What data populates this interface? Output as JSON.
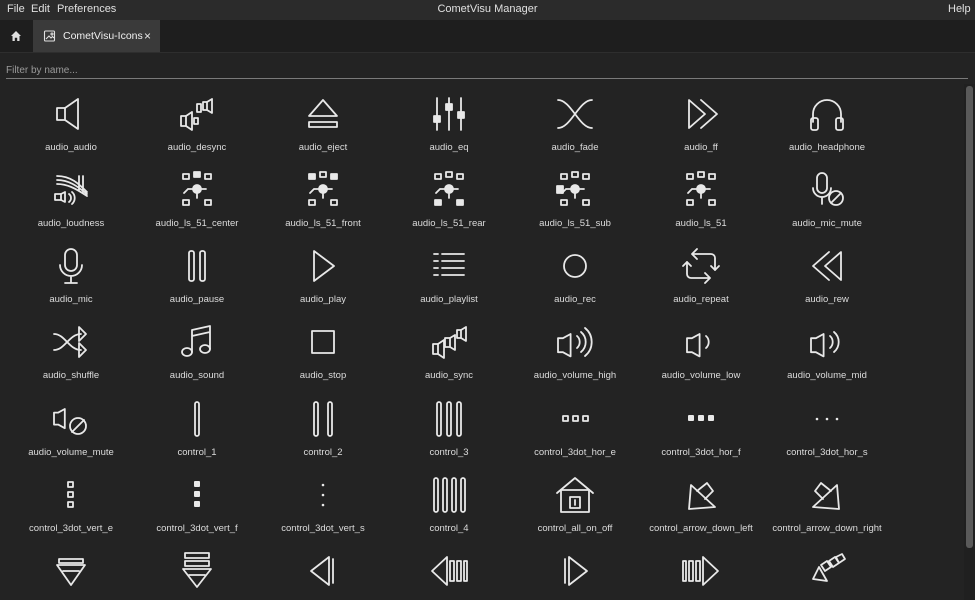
{
  "menubar": {
    "file": "File",
    "edit": "Edit",
    "preferences": "Preferences",
    "title": "CometVisu Manager",
    "help": "Help"
  },
  "tab": {
    "label": "CometVisu-Icons",
    "close": "×"
  },
  "filter": {
    "placeholder": "Filter by name..."
  },
  "icons": [
    {
      "label": "audio_audio",
      "icon": "speaker-icon"
    },
    {
      "label": "audio_desync",
      "icon": "speakers-desync-icon"
    },
    {
      "label": "audio_eject",
      "icon": "eject-icon"
    },
    {
      "label": "audio_eq",
      "icon": "equalizer-icon"
    },
    {
      "label": "audio_fade",
      "icon": "fade-icon"
    },
    {
      "label": "audio_ff",
      "icon": "fast-forward-icon"
    },
    {
      "label": "audio_headphone",
      "icon": "headphone-icon"
    },
    {
      "label": "audio_loudness",
      "icon": "loudness-icon"
    },
    {
      "label": "audio_ls_51_center",
      "icon": "surround-center-icon"
    },
    {
      "label": "audio_ls_51_front",
      "icon": "surround-front-icon"
    },
    {
      "label": "audio_ls_51_rear",
      "icon": "surround-rear-icon"
    },
    {
      "label": "audio_ls_51_sub",
      "icon": "surround-sub-icon"
    },
    {
      "label": "audio_ls_51",
      "icon": "surround-icon"
    },
    {
      "label": "audio_mic_mute",
      "icon": "mic-mute-icon"
    },
    {
      "label": "audio_mic",
      "icon": "mic-icon"
    },
    {
      "label": "audio_pause",
      "icon": "pause-icon"
    },
    {
      "label": "audio_play",
      "icon": "play-icon"
    },
    {
      "label": "audio_playlist",
      "icon": "playlist-icon"
    },
    {
      "label": "audio_rec",
      "icon": "record-icon"
    },
    {
      "label": "audio_repeat",
      "icon": "repeat-icon"
    },
    {
      "label": "audio_rew",
      "icon": "rewind-icon"
    },
    {
      "label": "audio_shuffle",
      "icon": "shuffle-icon"
    },
    {
      "label": "audio_sound",
      "icon": "music-note-icon"
    },
    {
      "label": "audio_stop",
      "icon": "stop-icon"
    },
    {
      "label": "audio_sync",
      "icon": "speakers-sync-icon"
    },
    {
      "label": "audio_volume_high",
      "icon": "volume-high-icon"
    },
    {
      "label": "audio_volume_low",
      "icon": "volume-low-icon"
    },
    {
      "label": "audio_volume_mid",
      "icon": "volume-mid-icon"
    },
    {
      "label": "audio_volume_mute",
      "icon": "volume-mute-icon"
    },
    {
      "label": "control_1",
      "icon": "one-bar-icon"
    },
    {
      "label": "control_2",
      "icon": "two-bars-icon"
    },
    {
      "label": "control_3",
      "icon": "three-bars-icon"
    },
    {
      "label": "control_3dot_hor_e",
      "icon": "dots-horizontal-empty-icon"
    },
    {
      "label": "control_3dot_hor_f",
      "icon": "dots-horizontal-filled-icon"
    },
    {
      "label": "control_3dot_hor_s",
      "icon": "dots-horizontal-small-icon"
    },
    {
      "label": "control_3dot_vert_e",
      "icon": "dots-vertical-empty-icon"
    },
    {
      "label": "control_3dot_vert_f",
      "icon": "dots-vertical-filled-icon"
    },
    {
      "label": "control_3dot_vert_s",
      "icon": "dots-vertical-small-icon"
    },
    {
      "label": "control_4",
      "icon": "four-bars-icon"
    },
    {
      "label": "control_all_on_off",
      "icon": "house-switch-icon"
    },
    {
      "label": "control_arrow_down_left",
      "icon": "arrow-down-left-icon"
    },
    {
      "label": "control_arrow_down_right",
      "icon": "arrow-down-right-icon"
    },
    {
      "label": "",
      "icon": "arrow-down-icon"
    },
    {
      "label": "",
      "icon": "arrow-down-stacked-icon"
    },
    {
      "label": "",
      "icon": "arrow-left-icon"
    },
    {
      "label": "",
      "icon": "arrow-left-stacked-icon"
    },
    {
      "label": "",
      "icon": "arrow-right-icon"
    },
    {
      "label": "",
      "icon": "arrow-right-stacked-icon"
    },
    {
      "label": "",
      "icon": "arrow-up-left-stacked-icon"
    }
  ]
}
